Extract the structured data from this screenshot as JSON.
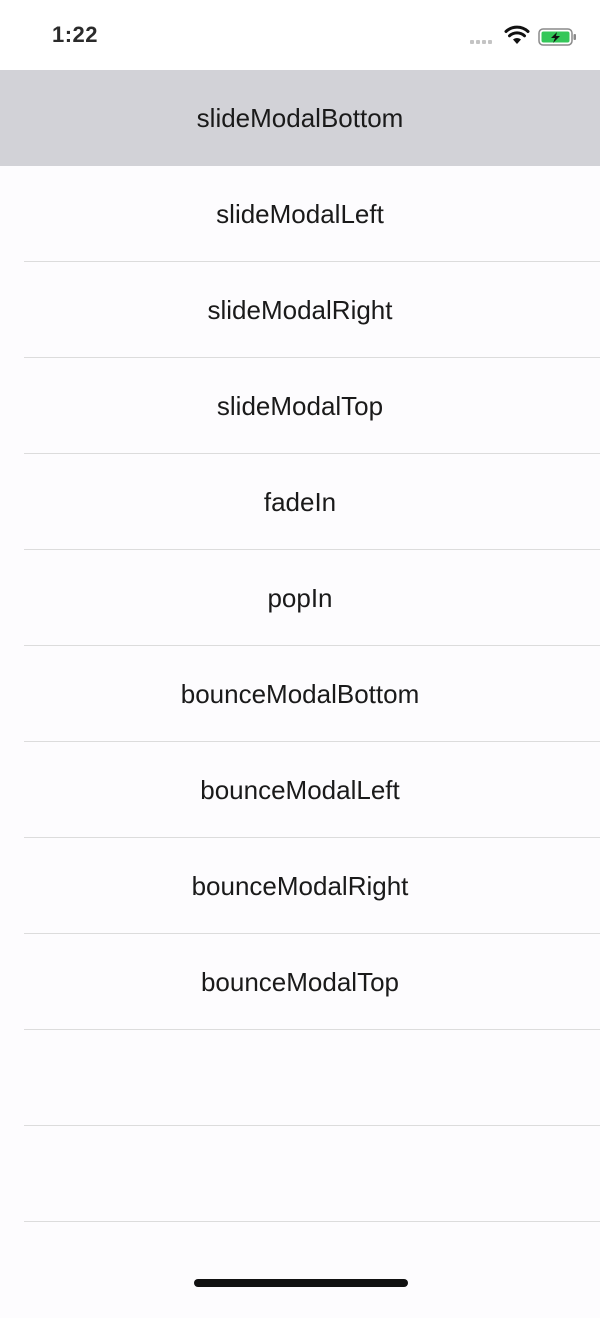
{
  "status_bar": {
    "time": "1:22",
    "battery_color": "#34c759"
  },
  "list": {
    "items": [
      {
        "label": "slideModalBottom",
        "selected": true
      },
      {
        "label": "slideModalLeft"
      },
      {
        "label": "slideModalRight"
      },
      {
        "label": "slideModalTop"
      },
      {
        "label": "fadeIn"
      },
      {
        "label": "popIn"
      },
      {
        "label": "bounceModalBottom"
      },
      {
        "label": "bounceModalLeft"
      },
      {
        "label": "bounceModalRight"
      },
      {
        "label": "bounceModalTop"
      },
      {
        "label": ""
      },
      {
        "label": ""
      },
      {
        "label": ""
      }
    ]
  }
}
